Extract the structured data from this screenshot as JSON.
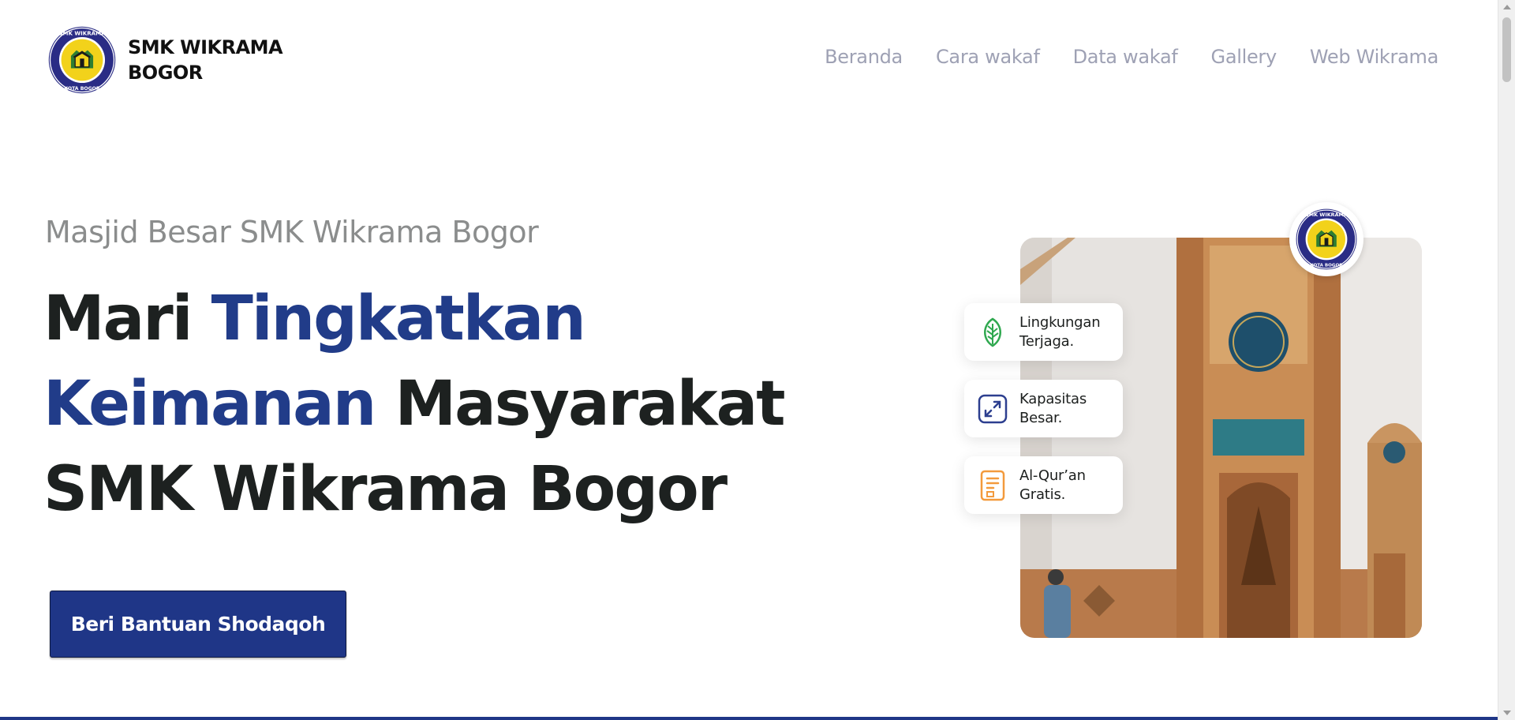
{
  "header": {
    "brand_line1": "SMK WIKRAMA",
    "brand_line2": "BOGOR",
    "logo_text_top": "SMK WIKRAMA",
    "logo_text_bottom": "KOTA BOGOR"
  },
  "nav": {
    "items": [
      "Beranda",
      "Cara wakaf",
      "Data wakaf",
      "Gallery",
      "Web Wikrama"
    ]
  },
  "hero": {
    "subtitle": "Masjid Besar SMK Wikrama Bogor",
    "headline_1": "Mari ",
    "headline_accent_1": "Tingkatkan",
    "headline_accent_2": "Keimanan",
    "headline_2": " Masyarakat",
    "headline_3": "SMK Wikrama Bogor",
    "cta_label": "Beri Bantuan Shodaqoh"
  },
  "features": [
    {
      "label": "Lingkungan\nTerjaga.",
      "icon": "leaf-icon",
      "color": "#2fa84f"
    },
    {
      "label": "Kapasitas\nBesar.",
      "icon": "expand-icon",
      "color": "#2d3f8f"
    },
    {
      "label": "Al-Qur’an\nGratis.",
      "icon": "book-icon",
      "color": "#f39a3c"
    }
  ],
  "colors": {
    "accent": "#213c89",
    "button": "#1f3687",
    "nav_text": "#9ea1b4"
  }
}
